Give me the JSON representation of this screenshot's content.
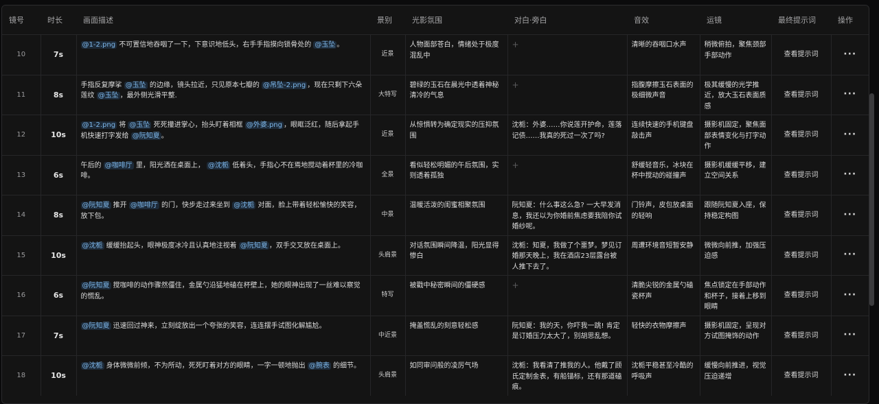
{
  "columns": [
    "镜号",
    "时长",
    "画面描述",
    "景别",
    "光影氛围",
    "对白·旁白",
    "音效",
    "运镜",
    "最终提示词",
    "操作"
  ],
  "view_label": "查看提示词",
  "more_icon": "···",
  "plus_icon": "+",
  "tag_color": "#7db6e8",
  "rows": [
    {
      "num": "10",
      "dur": "7s",
      "shot": "近景",
      "desc": [
        {
          "tag": "@1-2.png"
        },
        {
          "text": " 不可置信地吞咽了一下，下意识地低头，右手手指摸向锁骨处的 "
        },
        {
          "tag": "@玉坠"
        },
        {
          "text": "。"
        }
      ],
      "light": "人物面部苍白，情绪处于极度混乱中",
      "dialog": "",
      "sound": "清晰的吞咽口水声",
      "camera": "稍微俯拍，聚焦颈部手部动作"
    },
    {
      "num": "11",
      "dur": "8s",
      "shot": "大特写",
      "desc": [
        {
          "text": "手指反复摩挲 "
        },
        {
          "tag": "@玉坠"
        },
        {
          "text": " 的边缘，镜头拉近，只见原本七瓣的 "
        },
        {
          "tag": "@吊坠-2.png"
        },
        {
          "text": "，现在只剩下六朵莲纹 "
        },
        {
          "tag": "@玉坠"
        },
        {
          "text": "，最外侧光滑平整."
        }
      ],
      "light": "碧绿的玉石在晨光中透着神秘清冷的气息",
      "dialog": "",
      "sound": "指腹摩擦玉石表面的极细微声音",
      "camera": "极其缓慢的光学推近，放大玉石表面质感"
    },
    {
      "num": "12",
      "dur": "10s",
      "shot": "近景",
      "desc": [
        {
          "tag": "@1-2.png"
        },
        {
          "text": " 将 "
        },
        {
          "tag": "@玉坠"
        },
        {
          "text": " 死死攥进掌心，抬头盯着相框 "
        },
        {
          "tag": "@外婆.png"
        },
        {
          "text": "，眼眶泛红，随后拿起手机快速打字发给 "
        },
        {
          "tag": "@阮知夏"
        },
        {
          "text": "。"
        }
      ],
      "light": "从惊惧转为确定现实的压抑氛围",
      "dialog": "沈栀：外婆……你说莲开护命，莲落记债……我真的死过一次了吗?",
      "sound": "连续快速的手机键盘敲击声",
      "camera": "摄影机固定，聚焦面部表情变化与打字动作"
    },
    {
      "num": "13",
      "dur": "6s",
      "shot": "全景",
      "desc": [
        {
          "text": "午后的 "
        },
        {
          "tag": "@咖啡厅"
        },
        {
          "text": " 里，阳光洒在桌面上， "
        },
        {
          "tag": "@沈栀"
        },
        {
          "text": " 低着头，手指心不在焉地搅动着杯里的冷咖啡。"
        }
      ],
      "light": "看似轻松明媚的午后氛围，实则透着孤独",
      "dialog": "",
      "sound": "舒缓轻音乐，冰块在杯中搅动的碰撞声",
      "camera": "摄影机缓缓平移，建立空间关系"
    },
    {
      "num": "14",
      "dur": "8s",
      "shot": "中景",
      "desc": [
        {
          "tag": "@阮知夏"
        },
        {
          "text": " 推开 "
        },
        {
          "tag": "@咖啡厅"
        },
        {
          "text": " 的门，快步走过来坐到 "
        },
        {
          "tag": "@沈栀"
        },
        {
          "text": " 对面，脸上带着轻松愉快的笑容，放下包。"
        }
      ],
      "light": "温暖活泼的闺蜜相聚氛围",
      "dialog": "阮知夏：什么事这么急? 一大早发消息，我还以为你婚前焦虑要我陪你试婚纱呢。",
      "sound": "门铃声，皮包放桌面的轻响",
      "camera": "跟随阮知夏入座，保持稳定构图"
    },
    {
      "num": "15",
      "dur": "10s",
      "shot": "头肩景",
      "desc": [
        {
          "tag": "@沈栀"
        },
        {
          "text": " 缓缓抬起头，眼神极度冰冷且认真地注视着 "
        },
        {
          "tag": "@阮知夏"
        },
        {
          "text": "，双手交叉放在桌面上。"
        }
      ],
      "light": "对话氛围瞬间降温，阳光显得惨白",
      "dialog": "沈栀：知夏，我做了个噩梦。梦见订婚那天晚上，我在酒店23层露台被人推下去了。",
      "sound": "周遭环境音短暂安静",
      "camera": "微微向前推，加强压迫感"
    },
    {
      "num": "16",
      "dur": "6s",
      "shot": "特写",
      "desc": [
        {
          "tag": "@阮知夏"
        },
        {
          "text": " 搅咖啡的动作骤然僵住，金属勺沿猛地磕在杯壁上，她的眼神出现了一丝难以察觉的慌乱。"
        }
      ],
      "light": "被戳中秘密瞬间的僵硬感",
      "dialog": "",
      "sound": "清脆尖锐的金属勺磕瓷杯声",
      "camera": "焦点锁定在手部动作和杯子，接着上移到眼睛"
    },
    {
      "num": "17",
      "dur": "7s",
      "shot": "中近景",
      "desc": [
        {
          "tag": "@阮知夏"
        },
        {
          "text": " 迅速回过神来，立刻绽放出一个夸张的笑容，连连摆手试图化解尴尬。"
        }
      ],
      "light": "掩盖慌乱的刻意轻松感",
      "dialog": "阮知夏：我的天，你吓我一跳! 肯定是订婚压力太大了，别胡思乱想。",
      "sound": "轻快的衣物摩擦声",
      "camera": "摄影机固定，呈现对方试图掩饰的动作"
    },
    {
      "num": "18",
      "dur": "10s",
      "shot": "头肩景",
      "desc": [
        {
          "tag": "@沈栀"
        },
        {
          "text": " 身体微微前倾，不为所动，死死盯着对方的眼睛，一字一顿地抛出 "
        },
        {
          "tag": "@腕表"
        },
        {
          "text": " 的细节。"
        }
      ],
      "light": "如同审问般的凌厉气场",
      "dialog": "沈栀：我看清了推我的人。他戴了顾氏定制金表，有船锚标，还有那道磕痕。",
      "sound": "沈栀平稳甚至冷酷的呼吸声",
      "camera": "缓慢向前推进，视觉压迫递增"
    }
  ]
}
